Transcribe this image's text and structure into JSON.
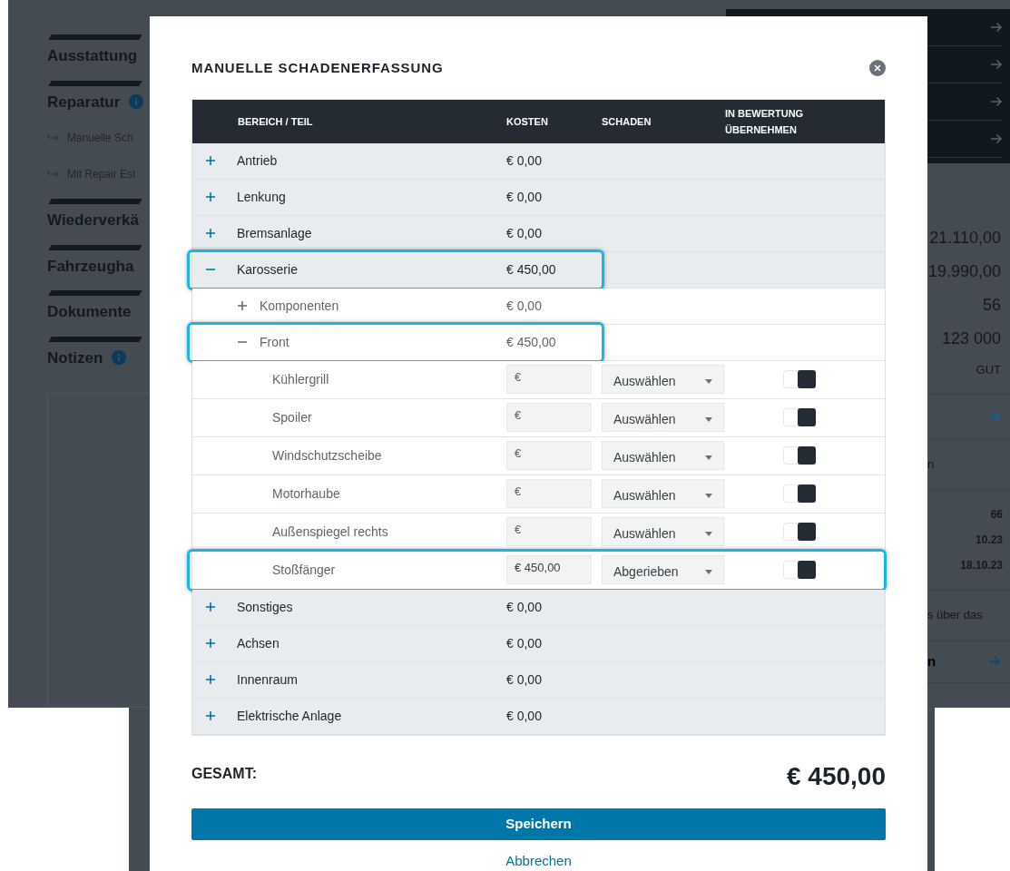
{
  "background": {
    "sidebar": [
      {
        "heading": "Ausstattung"
      },
      {
        "heading": "Reparatur",
        "info": true,
        "links": [
          "Manuelle Sch",
          "Mit Repair Est"
        ]
      },
      {
        "heading": "Wiederverkä"
      },
      {
        "heading": "Fahrzeugha"
      },
      {
        "heading": "Dokumente"
      },
      {
        "heading": "Notizen",
        "info": true
      }
    ],
    "panel": {
      "figures": [
        "21.110,00",
        "19.990,00",
        "56",
        "123 000"
      ],
      "rating": "GUT",
      "rows": [
        {
          "kind": "arrow"
        },
        {
          "kind": "text",
          "text": "n"
        },
        {
          "kind": "values",
          "values": [
            "66",
            "10.23",
            "18.10.23"
          ]
        },
        {
          "kind": "text",
          "text": "s über das"
        },
        {
          "kind": "text_arrow",
          "text": "n"
        }
      ]
    }
  },
  "modal": {
    "title": "MANUELLE SCHADENERFASSUNG",
    "columns": [
      "BEREICH / TEIL",
      "KOSTEN",
      "SCHADEN",
      "IN BEWERTUNG ÜBERNEHMEN"
    ],
    "areas": [
      {
        "name": "Antrieb",
        "cost": "€ 0,00",
        "expanded": false,
        "highlighted": false
      },
      {
        "name": "Lenkung",
        "cost": "€ 0,00",
        "expanded": false,
        "highlighted": false
      },
      {
        "name": "Bremsanlage",
        "cost": "€ 0,00",
        "expanded": false,
        "highlighted": false
      },
      {
        "name": "Karosserie",
        "cost": "€ 450,00",
        "expanded": true,
        "highlighted": true,
        "children": [
          {
            "name": "Komponenten",
            "cost": "€ 0,00",
            "expanded": false,
            "highlighted": false
          },
          {
            "name": "Front",
            "cost": "€ 450,00",
            "expanded": true,
            "highlighted": true,
            "children": [
              {
                "name": "Kühlergrill",
                "cost_placeholder": "€",
                "damage": "Auswählen",
                "adopt": true,
                "highlighted": false
              },
              {
                "name": "Spoiler",
                "cost_placeholder": "€",
                "damage": "Auswählen",
                "adopt": true,
                "highlighted": false
              },
              {
                "name": "Windschutzscheibe",
                "cost_placeholder": "€",
                "damage": "Auswählen",
                "adopt": true,
                "highlighted": false
              },
              {
                "name": "Motorhaube",
                "cost_placeholder": "€",
                "damage": "Auswählen",
                "adopt": true,
                "highlighted": false
              },
              {
                "name": "Außenspiegel rechts",
                "cost_placeholder": "€",
                "damage": "Auswählen",
                "adopt": true,
                "highlighted": false
              },
              {
                "name": "Stoßfänger",
                "cost_value": "€ 450,00",
                "damage": "Abgerieben",
                "adopt": true,
                "highlighted": true
              }
            ]
          }
        ]
      },
      {
        "name": "Sonstiges",
        "cost": "€ 0,00",
        "expanded": false,
        "highlighted": false
      },
      {
        "name": "Achsen",
        "cost": "€ 0,00",
        "expanded": false,
        "highlighted": false
      },
      {
        "name": "Innenraum",
        "cost": "€ 0,00",
        "expanded": false,
        "highlighted": false
      },
      {
        "name": "Elektrische Anlage",
        "cost": "€ 0,00",
        "expanded": false,
        "highlighted": false
      }
    ],
    "total_label": "GESAMT:",
    "total": "€ 450,00",
    "save": "Speichern",
    "cancel": "Abbrechen"
  }
}
